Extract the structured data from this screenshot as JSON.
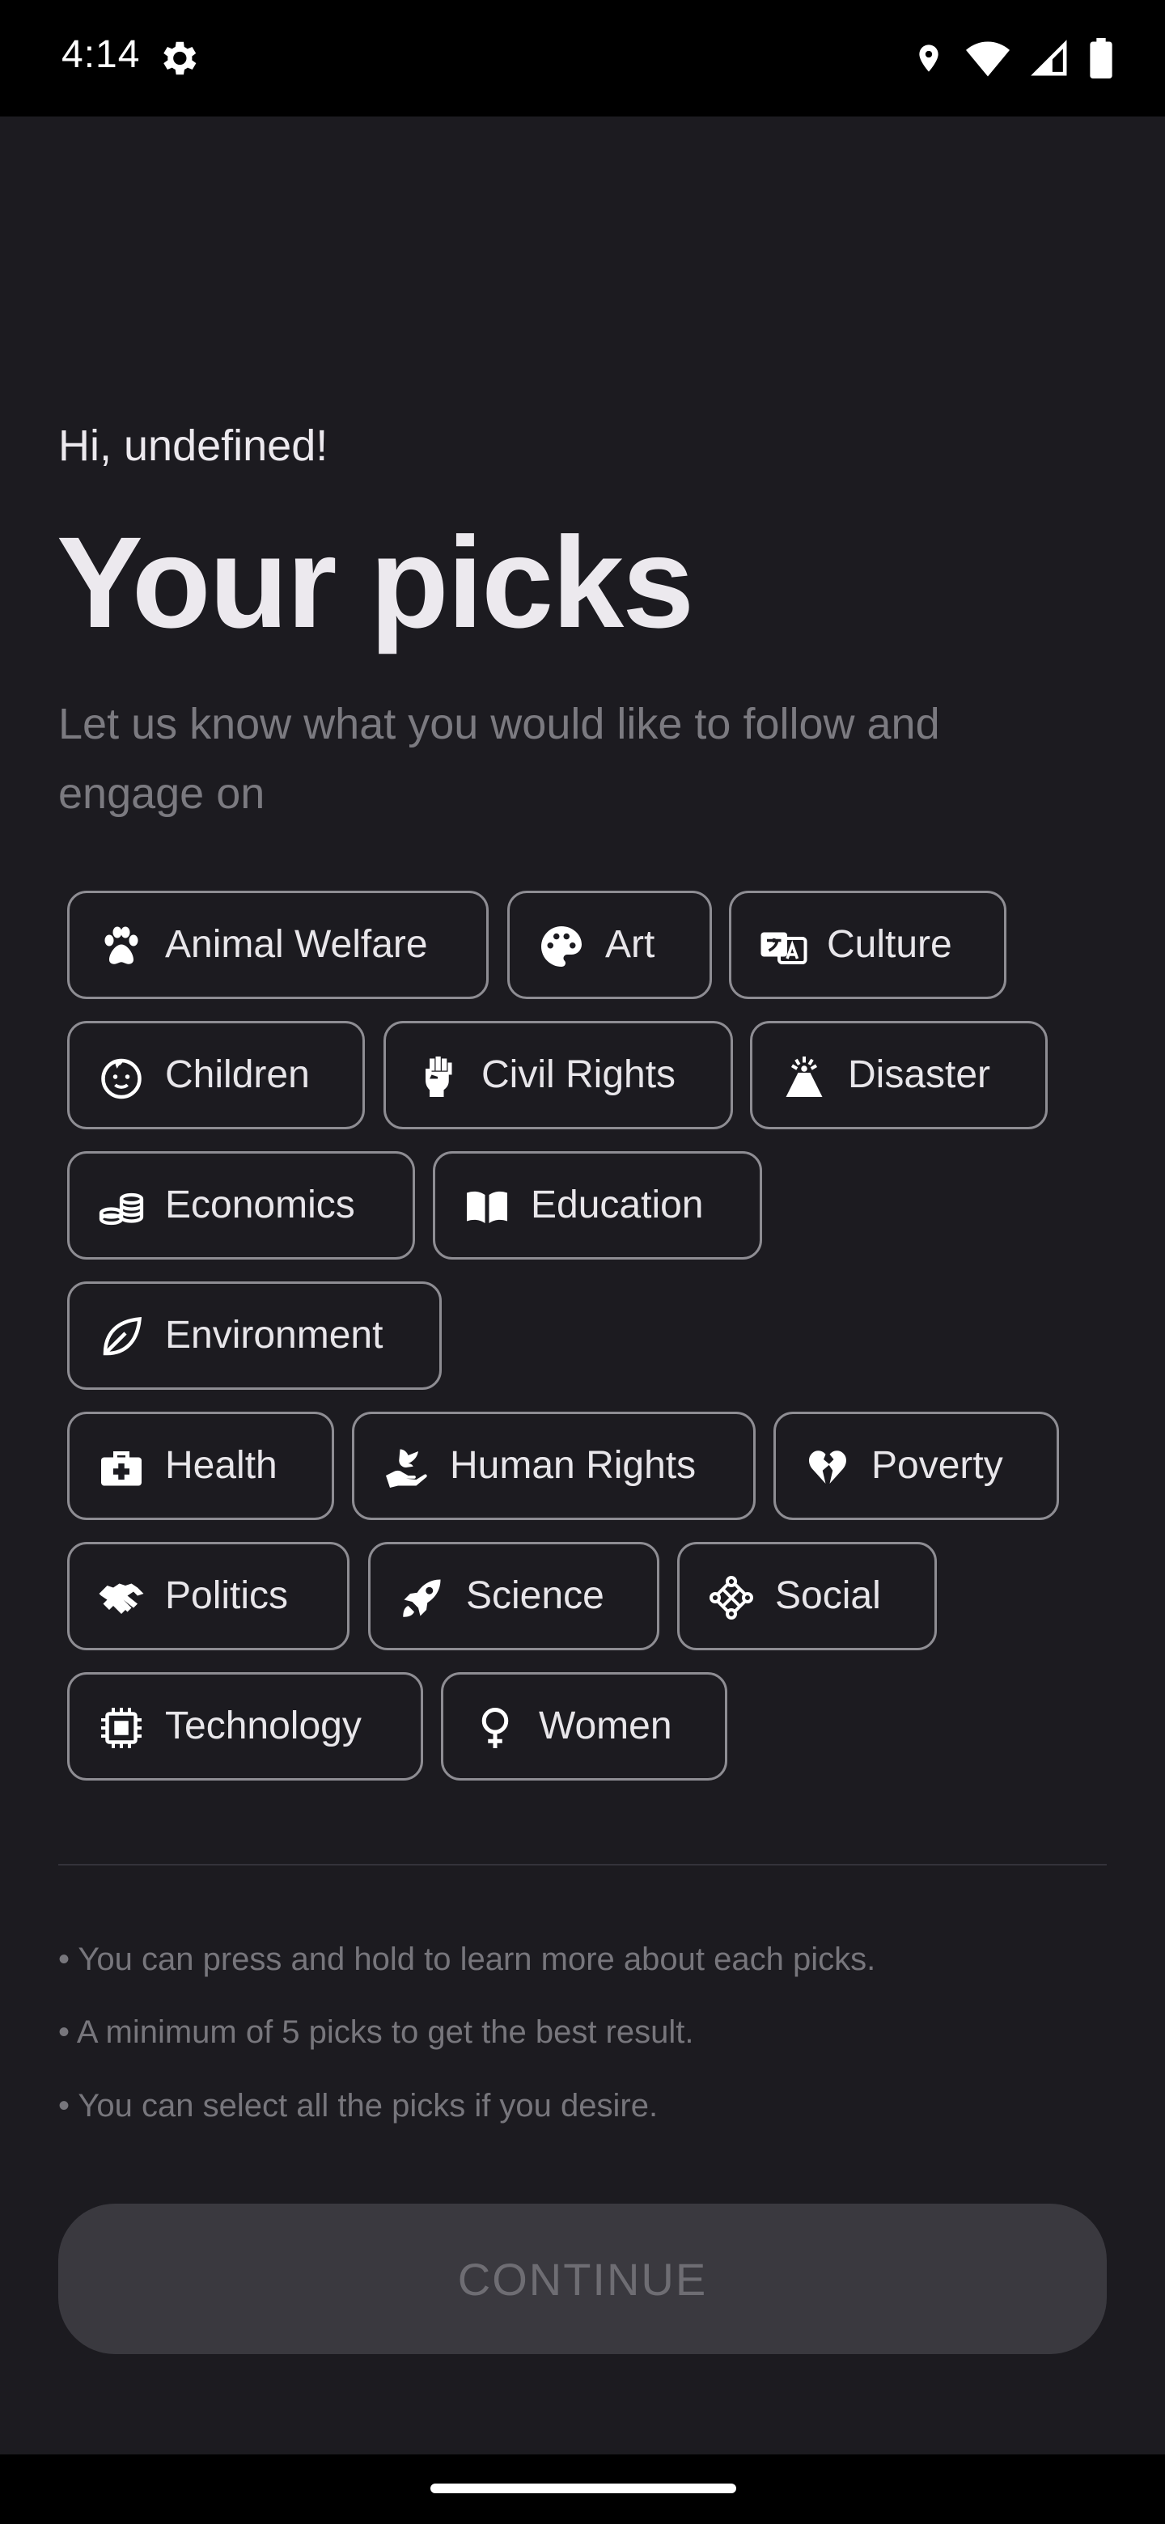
{
  "status_bar": {
    "time": "4:14"
  },
  "header": {
    "greeting": "Hi, undefined!",
    "title": "Your picks",
    "subtitle": "Let us know what you would like to follow and engage on"
  },
  "picks": [
    {
      "label": "Animal Welfare",
      "icon": "paw-icon"
    },
    {
      "label": "Art",
      "icon": "palette-icon"
    },
    {
      "label": "Culture",
      "icon": "translate-icon"
    },
    {
      "label": "Children",
      "icon": "baby-face-icon"
    },
    {
      "label": "Civil Rights",
      "icon": "raised-fist-icon"
    },
    {
      "label": "Disaster",
      "icon": "volcano-icon"
    },
    {
      "label": "Economics",
      "icon": "coins-icon"
    },
    {
      "label": "Education",
      "icon": "open-book-icon"
    },
    {
      "label": "Environment",
      "icon": "leaf-icon"
    },
    {
      "label": "Health",
      "icon": "medical-kit-icon"
    },
    {
      "label": "Human Rights",
      "icon": "dove-hand-icon"
    },
    {
      "label": "Poverty",
      "icon": "broken-heart-icon"
    },
    {
      "label": "Politics",
      "icon": "handshake-icon"
    },
    {
      "label": "Science",
      "icon": "rocket-icon"
    },
    {
      "label": "Social",
      "icon": "people-circle-icon"
    },
    {
      "label": "Technology",
      "icon": "chip-icon"
    },
    {
      "label": "Women",
      "icon": "venus-icon"
    }
  ],
  "tips": [
    "• You can press and hold to learn more about each picks.",
    "• A minimum of 5 picks to get the best result.",
    "• You can select all the picks if you desire."
  ],
  "continue_label": "CONTINUE"
}
